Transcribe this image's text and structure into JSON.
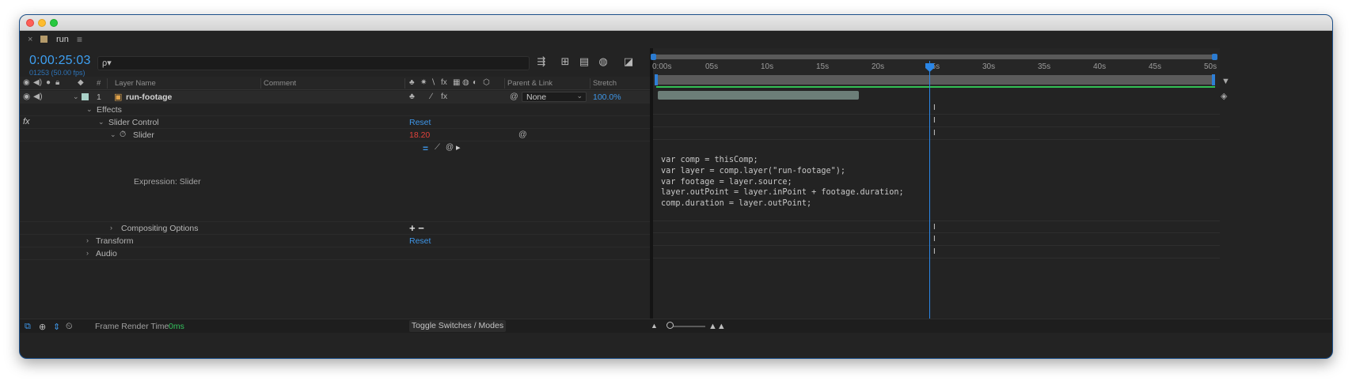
{
  "panel": {
    "close": "×",
    "title": "run",
    "menu": "≡"
  },
  "comp": {
    "timecode": "0:00:25:03",
    "frames": "01253 (50.00 fps)",
    "search_icon": "ρ▾"
  },
  "toolbar_icons": [
    "composition-mini-flowchart-icon",
    "draft-3d-icon",
    "frame-blending-icon",
    "motion-blur-icon",
    "graph-editor-icon"
  ],
  "columns": {
    "number": "#",
    "layer_name": "Layer Name",
    "comment": "Comment",
    "parent_link": "Parent & Link",
    "stretch": "Stretch"
  },
  "layer": {
    "index": "1",
    "name": "run-footage",
    "parent": "None",
    "stretch": "100.0%"
  },
  "tree": {
    "effects": "Effects",
    "fx_badge": "fx",
    "slider_control": "Slider Control",
    "slider_control_reset": "Reset",
    "slider": "Slider",
    "slider_value": "18.20",
    "expression_label": "Expression: Slider",
    "compositing_options": "Compositing Options",
    "compositing_plus_minus": "+ −",
    "transform": "Transform",
    "transform_reset": "Reset",
    "audio": "Audio"
  },
  "ruler": {
    "labels": [
      "0:00s",
      "05s",
      "10s",
      "15s",
      "20s",
      "25s",
      "30s",
      "35s",
      "40s",
      "45s",
      "50s"
    ]
  },
  "expression_code": "var comp = thisComp;\nvar layer = comp.layer(\"run-footage\");\nvar footage = layer.source;\nlayer.outPoint = layer.inPoint + footage.duration;\ncomp.duration = layer.outPoint;",
  "bottom": {
    "frame_render_time_label": "Frame Render Time",
    "frame_render_time_value": "0ms",
    "toggle_label": "Toggle Switches / Modes"
  },
  "colors": {
    "accent": "#3ea0f2",
    "playhead": "#2b86e6",
    "value_red": "#e2423b",
    "green": "#33c154"
  }
}
